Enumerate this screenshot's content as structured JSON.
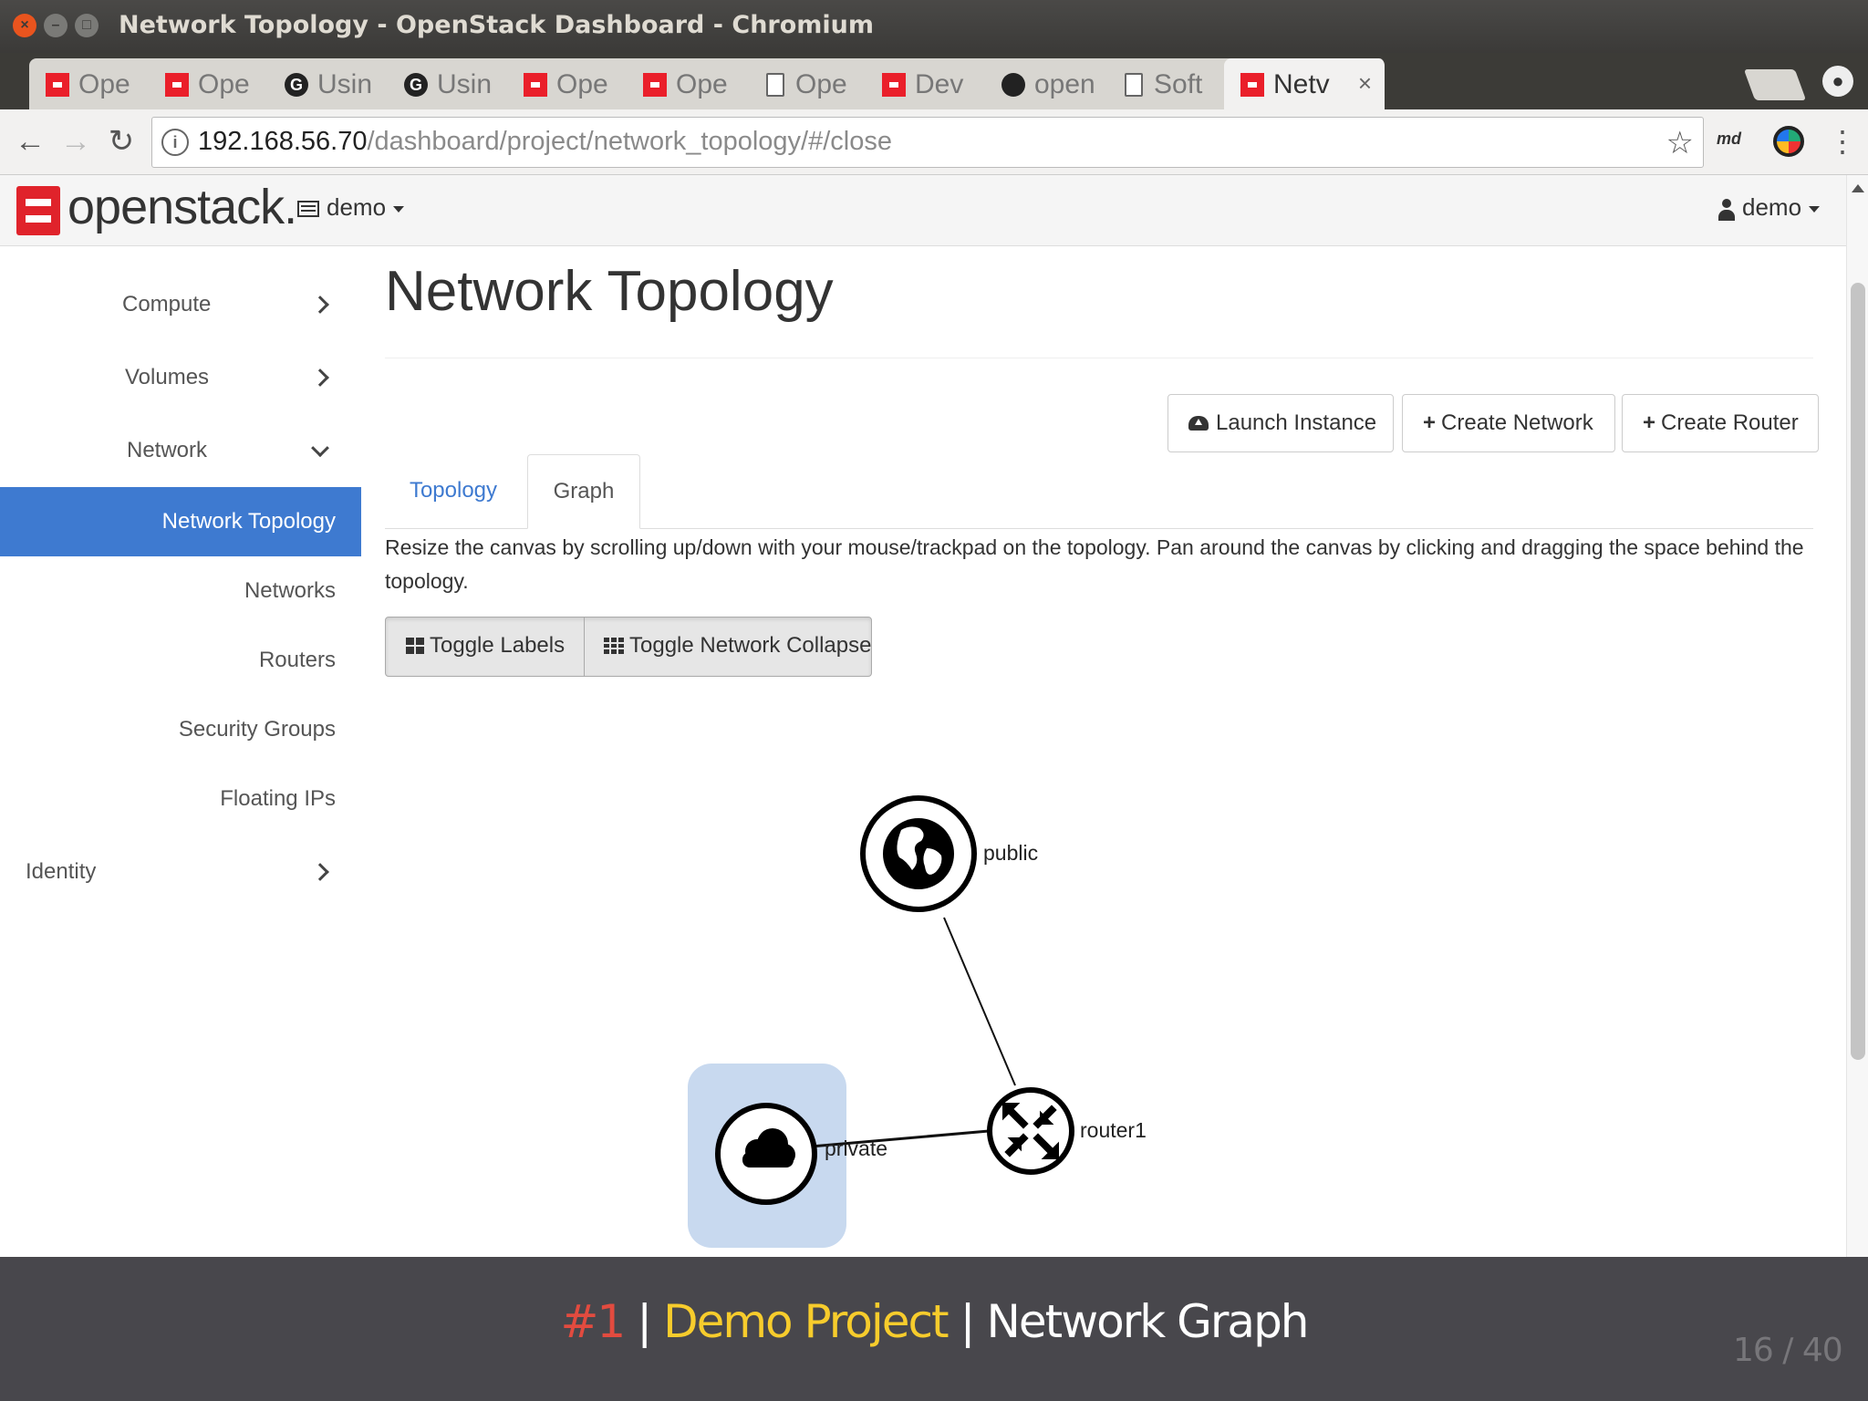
{
  "window": {
    "title": "Network Topology - OpenStack Dashboard - Chromium",
    "close_glyph": "×",
    "min_glyph": "–",
    "max_glyph": "□"
  },
  "tabs": [
    {
      "label": "Ope",
      "icon": "openstack-icon"
    },
    {
      "label": "Ope",
      "icon": "openstack-icon"
    },
    {
      "label": "Usin",
      "icon": "g-icon"
    },
    {
      "label": "Usin",
      "icon": "g-icon"
    },
    {
      "label": "Ope",
      "icon": "openstack-icon"
    },
    {
      "label": "Ope",
      "icon": "openstack-icon"
    },
    {
      "label": "Ope",
      "icon": "document-icon"
    },
    {
      "label": "Dev",
      "icon": "openstack-icon"
    },
    {
      "label": "open",
      "icon": "github-icon"
    },
    {
      "label": "Soft",
      "icon": "document-icon"
    },
    {
      "label": "Netv",
      "icon": "openstack-icon",
      "active": true
    }
  ],
  "tab_close_glyph": "×",
  "g_glyph": "G",
  "browser": {
    "back_glyph": "←",
    "forward_glyph": "→",
    "reload_glyph": "↻",
    "info_glyph": "i",
    "url_host": "192.168.56.70",
    "url_path": "/dashboard/project/network_topology/#/close",
    "star_glyph": "☆",
    "ext_label": "md",
    "menu_glyph": "⋮"
  },
  "navbar": {
    "brand": "openstack.",
    "project": "demo",
    "user": "demo"
  },
  "sidebar": {
    "items": [
      {
        "label": "Compute",
        "chevron": "right"
      },
      {
        "label": "Volumes",
        "chevron": "right"
      },
      {
        "label": "Network",
        "chevron": "down"
      },
      {
        "label": "Network Topology",
        "active": true
      },
      {
        "label": "Networks"
      },
      {
        "label": "Routers"
      },
      {
        "label": "Security Groups"
      },
      {
        "label": "Floating IPs"
      },
      {
        "label": "Identity",
        "chevron": "right"
      }
    ]
  },
  "main": {
    "title": "Network Topology",
    "actions": {
      "launch": "Launch Instance",
      "create_network": "Create Network",
      "create_router": "Create Router",
      "plus_glyph": "+"
    },
    "tabs": {
      "topology": "Topology",
      "graph": "Graph"
    },
    "help": "Resize the canvas by scrolling up/down with your mouse/trackpad on the topology. Pan around the canvas by clicking and dragging the space behind the topology.",
    "toggles": {
      "labels": "Toggle Labels",
      "collapse": "Toggle Network Collapse"
    }
  },
  "graph": {
    "nodes": {
      "public": {
        "label": "public",
        "icon": "globe-icon"
      },
      "router1": {
        "label": "router1",
        "icon": "router-icon"
      },
      "private": {
        "label": "private",
        "icon": "cloud-icon",
        "highlight": "#c8d9ef"
      }
    }
  },
  "footer": {
    "num": "#1",
    "sep": "|",
    "project": "Demo Project",
    "topic": "Network Graph",
    "counter": "16 / 40"
  },
  "colors": {
    "accent": "#3e7ad0",
    "openstack_red": "#e0232b",
    "footer_bg": "#48474c",
    "footer_num": "#e24b3f",
    "footer_project": "#f7cc2c"
  }
}
